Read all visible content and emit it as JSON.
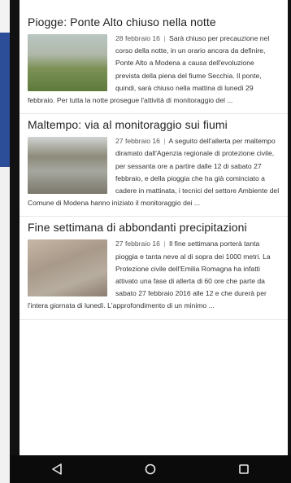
{
  "articles": [
    {
      "title": "Piogge: Ponte Alto chiuso nella notte",
      "date": "28 febbraio 16",
      "separator": "|",
      "text": "Sarà chiuso per precauzione nel corso della notte, in un orario ancora da definire, Ponte Alto a Modena a causa dell'evoluzione prevista della piena del fiume Secchia. Il ponte, quindi, sarà chiuso nella mattina di lunedì 29 febbraio. Per tutta la notte prosegue l'attività di monitoraggio del ..."
    },
    {
      "title": "Maltempo: via al monitoraggio sui fiumi",
      "date": "27 febbraio 16",
      "separator": "|",
      "text": "A seguito dell'allerta per maltempo diramato dall'Agenzia regionale di protezione civile, per sessanta ore a partire dalle 12 di sabato 27 febbraio, e della pioggia che ha già cominciato a cadere in mattinata, i tecnici del settore Ambiente del Comune di Modena hanno iniziato il monitoraggio dei ..."
    },
    {
      "title": "Fine settimana di abbondanti precipitazioni",
      "date": "27 febbraio 16",
      "separator": "|",
      "text": "Il fine settimana porterà tanta pioggia e tanta neve al di sopra dei 1000 metri. La Protezione civile dell'Emilia Romagna ha infatti attivato una fase di allerta di 60 ore che parte da sabato 27 febbraio 2016 alle 12 e che durerà per l'intera giornata di lunedì. L'approfondimento di un minimo ..."
    }
  ],
  "navbar": {
    "back_icon": "back-triangle-icon",
    "home_icon": "home-circle-icon",
    "recents_icon": "recents-square-icon"
  }
}
